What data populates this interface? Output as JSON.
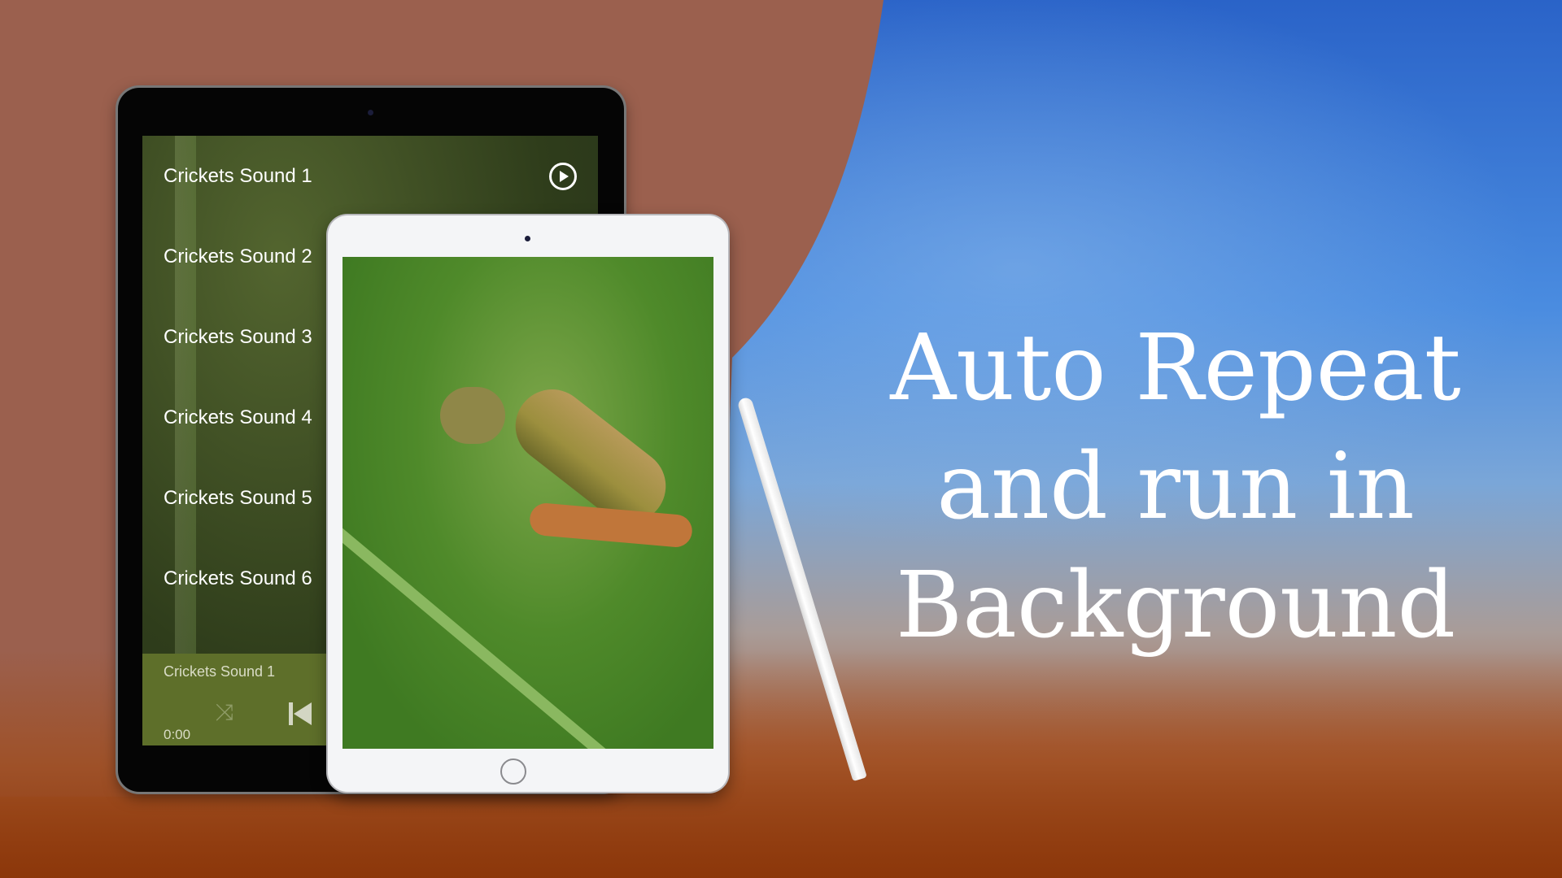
{
  "headline": {
    "line1": "Auto Repeat",
    "line2": "and run in",
    "line3": "Background"
  },
  "app": {
    "playlist": [
      {
        "label": "Crickets Sound 1"
      },
      {
        "label": "Crickets Sound 2"
      },
      {
        "label": "Crickets Sound 3"
      },
      {
        "label": "Crickets Sound 4"
      },
      {
        "label": "Crickets Sound 5"
      },
      {
        "label": "Crickets Sound 6"
      }
    ],
    "player": {
      "now_playing": "Crickets Sound 1",
      "time": "0:00"
    },
    "icons": {
      "play": "play-circle-icon",
      "shuffle": "shuffle-icon",
      "previous": "skip-previous-icon"
    }
  },
  "colors": {
    "brown": "#9b604e",
    "sky_blue": "#2a63c8",
    "player_bar": "#5e6f2a"
  }
}
